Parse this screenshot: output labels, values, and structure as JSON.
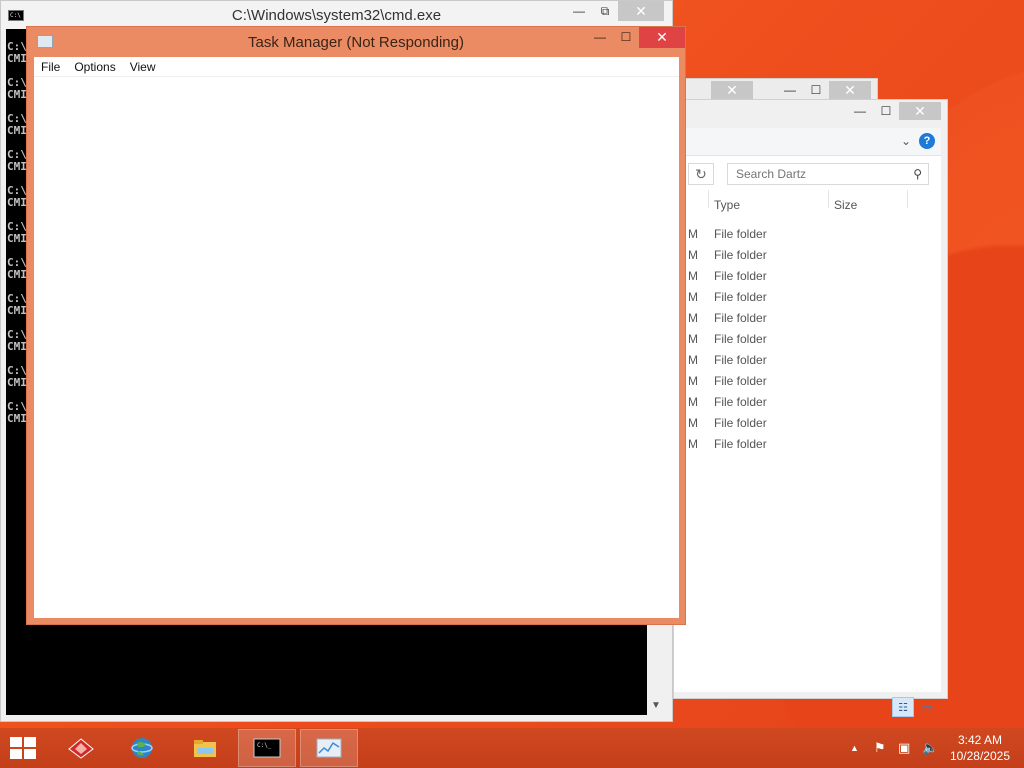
{
  "cmd": {
    "title": "C:\\Windows\\system32\\cmd.exe",
    "lines": [
      "C:\\",
      "CMI"
    ]
  },
  "caption": {
    "minimize": "—",
    "maximize": "☐",
    "restore": "⧉",
    "close": "✕"
  },
  "task_manager": {
    "title": "Task Manager (Not Responding)",
    "menu": [
      "File",
      "Options",
      "View"
    ]
  },
  "explorer": {
    "search_placeholder": "Search Dartz",
    "columns": {
      "type": "Type",
      "size": "Size"
    },
    "row_prefix": "M",
    "rows": [
      "File folder",
      "File folder",
      "File folder",
      "File folder",
      "File folder",
      "File folder",
      "File folder",
      "File folder",
      "File folder",
      "File folder",
      "File folder"
    ],
    "refresh_icon": "refresh-icon",
    "search_icon": "magnifier-icon",
    "help_icon": "help-icon"
  },
  "taskbar": {
    "items": [
      "start-icon",
      "app-red-icon",
      "browser-globe-icon",
      "file-explorer-icon",
      "cmd-icon",
      "task-manager-icon"
    ],
    "tray": [
      "show-hidden-icons",
      "action-center-flag-icon",
      "network-icon",
      "volume-muted-icon"
    ],
    "time": "3:42 AM",
    "date": "10/28/2025"
  },
  "colors": {
    "desktop": "#ef4f1d",
    "taskbar": "#c33f1a",
    "task_manager_frame": "#eb8b63",
    "close_red": "#e04343"
  }
}
